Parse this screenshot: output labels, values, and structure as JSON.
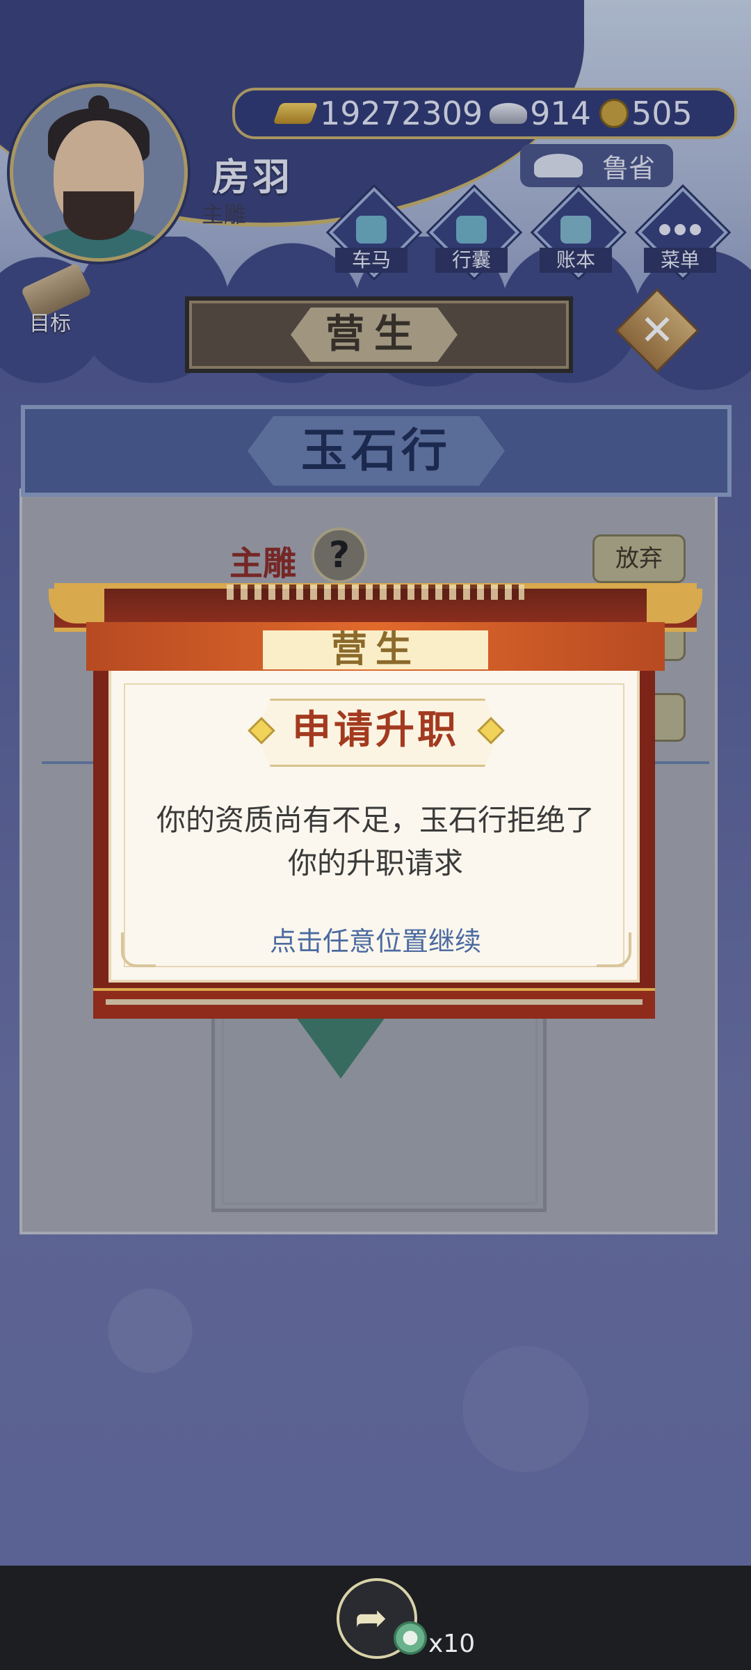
{
  "player": {
    "name": "房羽",
    "rank": "主雕",
    "region": "鲁省"
  },
  "currency": {
    "gold": "19272309",
    "silver": "914",
    "coins": "505"
  },
  "nav": {
    "items": [
      {
        "label": "车马"
      },
      {
        "label": "行囊"
      },
      {
        "label": "账本"
      },
      {
        "label": "菜单"
      }
    ],
    "goal_label": "目标"
  },
  "header": {
    "banner_title": "营生"
  },
  "panel": {
    "shop_title": "玉石行",
    "position_label": "主雕",
    "help_icon": "?",
    "quit_label": "放弃"
  },
  "dialog": {
    "band_title": "营生",
    "heading": "申请升职",
    "message_line1": "你的资质尚有不足，玉石行拒绝了",
    "message_line2": "你的升职请求",
    "tap_hint": "点击任意位置继续"
  },
  "bottom": {
    "share_multiplier": "x10"
  },
  "colors": {
    "accent_gold": "#d9a94e",
    "dialog_red": "#8f2f1e",
    "dialog_orange": "#e16a2c",
    "heading_red": "#a33a20",
    "hint_blue": "#4b6aa0"
  },
  "icons": [
    "gold-ingot-icon",
    "silver-ingot-icon",
    "copper-coin-icon",
    "carriage-icon",
    "bag-icon",
    "ledger-icon",
    "menu-dots-icon",
    "scroll-icon",
    "close-icon",
    "help-icon",
    "share-icon",
    "jade-token-icon"
  ]
}
